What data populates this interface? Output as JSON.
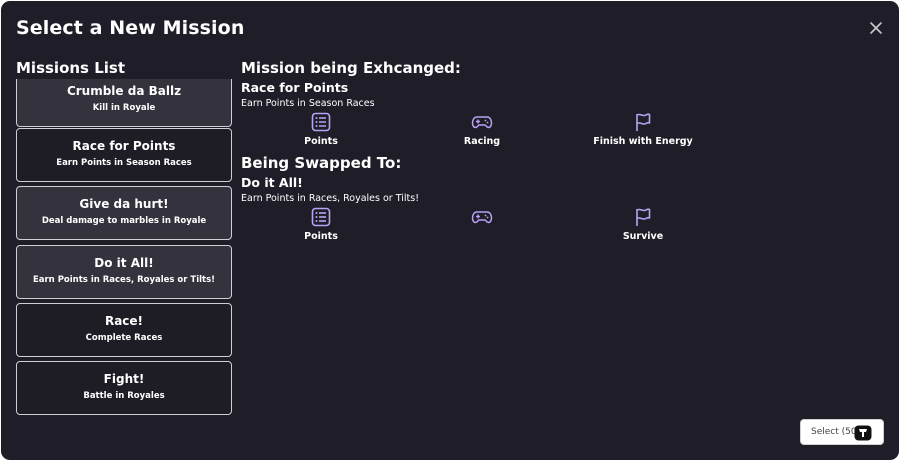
{
  "dialog": {
    "title": "Select a New Mission",
    "close_icon": "close-icon"
  },
  "missions_list": {
    "title": "Missions List",
    "items": [
      {
        "name": "Crumble da Ballz",
        "description": "Kill in Royale",
        "highlighted": true
      },
      {
        "name": "Race for Points",
        "description": "Earn Points in Season Races",
        "highlighted": false
      },
      {
        "name": "Give da hurt!",
        "description": "Deal damage to marbles in Royale",
        "highlighted": true
      },
      {
        "name": "Do it All!",
        "description": "Earn Points in Races, Royales or Tilts!",
        "highlighted": true
      },
      {
        "name": "Race!",
        "description": "Complete Races",
        "highlighted": false
      },
      {
        "name": "Fight!",
        "description": "Battle in Royales",
        "highlighted": false
      }
    ]
  },
  "current": {
    "heading": "Mission being Exhcanged:",
    "mission_name": "Race for Points",
    "mission_description": "Earn Points in Season Races",
    "objectives": [
      {
        "icon": "list-icon",
        "label": "Points"
      },
      {
        "icon": "gamepad-icon",
        "label": "Racing"
      },
      {
        "icon": "flag-icon",
        "label": "Finish with Energy"
      }
    ]
  },
  "swap": {
    "heading": "Being Swapped To:",
    "mission_name": "Do it All!",
    "mission_description": "Earn Points in Races, Royales or Tilts!",
    "objectives": [
      {
        "icon": "list-icon",
        "label": "Points"
      },
      {
        "icon": "gamepad-icon",
        "label": ""
      },
      {
        "icon": "flag-icon",
        "label": "Survive"
      }
    ]
  },
  "select_button": {
    "label": "Select (50",
    "icon": "coin-icon"
  },
  "colors": {
    "background": "#1f1e28",
    "card_highlight": "#34333d",
    "icon_accent": "#b8a2f5"
  }
}
